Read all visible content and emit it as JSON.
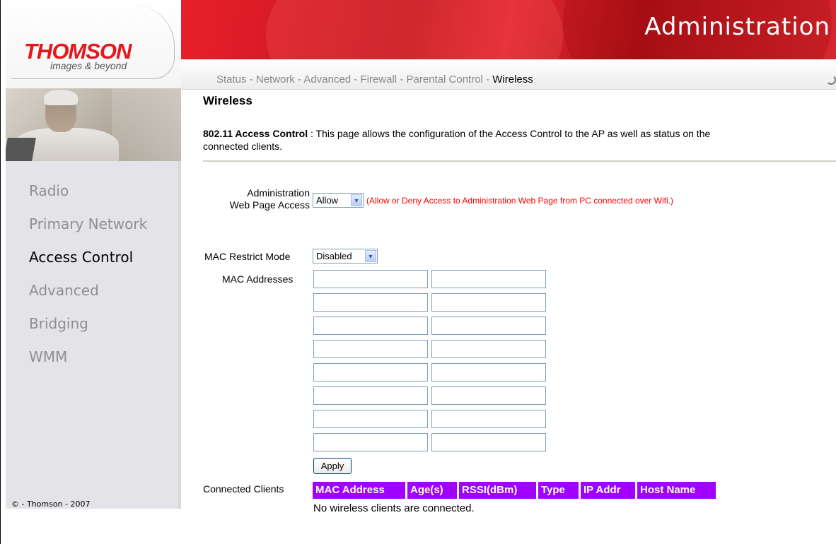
{
  "brand": {
    "name": "THOMSON",
    "tagline": "images & beyond"
  },
  "header": {
    "title": "Administration"
  },
  "nav": [
    {
      "label": "Status",
      "active": false
    },
    {
      "label": "Network",
      "active": false
    },
    {
      "label": "Advanced",
      "active": false
    },
    {
      "label": "Firewall",
      "active": false
    },
    {
      "label": "Parental Control",
      "active": false
    },
    {
      "label": "Wireless",
      "active": true
    }
  ],
  "nav_separator": " - ",
  "sidebar": {
    "items": [
      {
        "label": "Radio",
        "active": false
      },
      {
        "label": "Primary Network",
        "active": false
      },
      {
        "label": "Access Control",
        "active": true
      },
      {
        "label": "Advanced",
        "active": false
      },
      {
        "label": "Bridging",
        "active": false
      },
      {
        "label": "WMM",
        "active": false
      }
    ],
    "copyright": "© - Thomson - 2007"
  },
  "main": {
    "title": "Wireless",
    "desc_bold": "802.11 Access Control",
    "desc_line1": " :  This page allows the configuration of the Access Control to the AP as well as status on the",
    "desc_line2": "connected clients.",
    "admin_access": {
      "label_line1": "Administration",
      "label_line2": "Web Page Access",
      "value": "Allow",
      "note": "(Allow or Deny Access to Administration Web Page from PC connected over Wifi.)"
    },
    "mac_restrict": {
      "label": "MAC Restrict Mode",
      "value": "Disabled"
    },
    "mac_addresses": {
      "label": "MAC Addresses",
      "values": [
        "",
        "",
        "",
        "",
        "",
        "",
        "",
        "",
        "",
        "",
        "",
        "",
        "",
        "",
        "",
        ""
      ]
    },
    "apply_label": "Apply",
    "connected_clients": {
      "label": "Connected Clients",
      "headers": [
        "MAC Address",
        "Age(s)",
        "RSSI(dBm)",
        "Type",
        "IP Addr",
        "Host Name"
      ],
      "empty_text": "No wireless clients are connected."
    }
  },
  "colors": {
    "brand_red": "#e5171d",
    "table_header": "#a200ff",
    "note_red": "#ff0000"
  }
}
